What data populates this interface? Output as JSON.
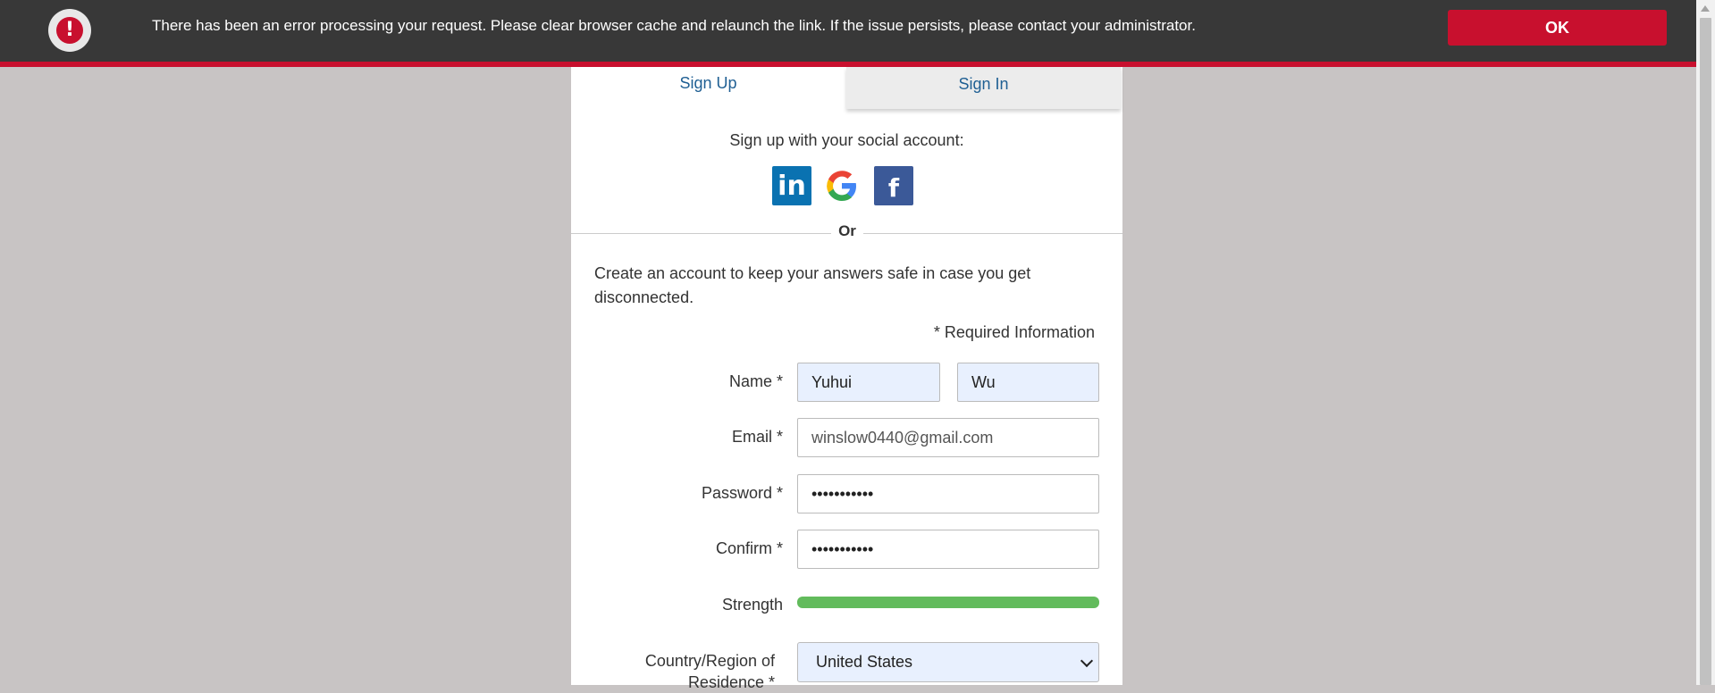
{
  "error_banner": {
    "message": "There has been an error processing your request. Please clear browser cache and relaunch the link. If the issue persists, please contact your administrator.",
    "icon": "!",
    "ok_label": "OK",
    "colors": {
      "accent": "#c8102e",
      "background": "#383838"
    }
  },
  "tabs": {
    "signup": "Sign Up",
    "signin": "Sign In"
  },
  "social": {
    "label": "Sign up with your social account:",
    "linkedin_glyph": "in",
    "facebook_glyph": "f"
  },
  "or_label": "Or",
  "intro_text": "Create an account to keep your answers safe in case you get disconnected.",
  "required_info": "* Required Information",
  "form": {
    "name_label": "Name *",
    "first_name": "Yuhui",
    "last_name": "Wu",
    "email_label": "Email *",
    "email": "winslow0440@gmail.com",
    "password_label": "Password *",
    "password_mask": "•••••••••••",
    "confirm_label": "Confirm *",
    "confirm_mask": "•••••••••••",
    "strength_label": "Strength",
    "strength_fraction": 1.0,
    "country_label_line1": "Country/Region of",
    "country_label_line2": "Residence *",
    "country": "United States"
  }
}
